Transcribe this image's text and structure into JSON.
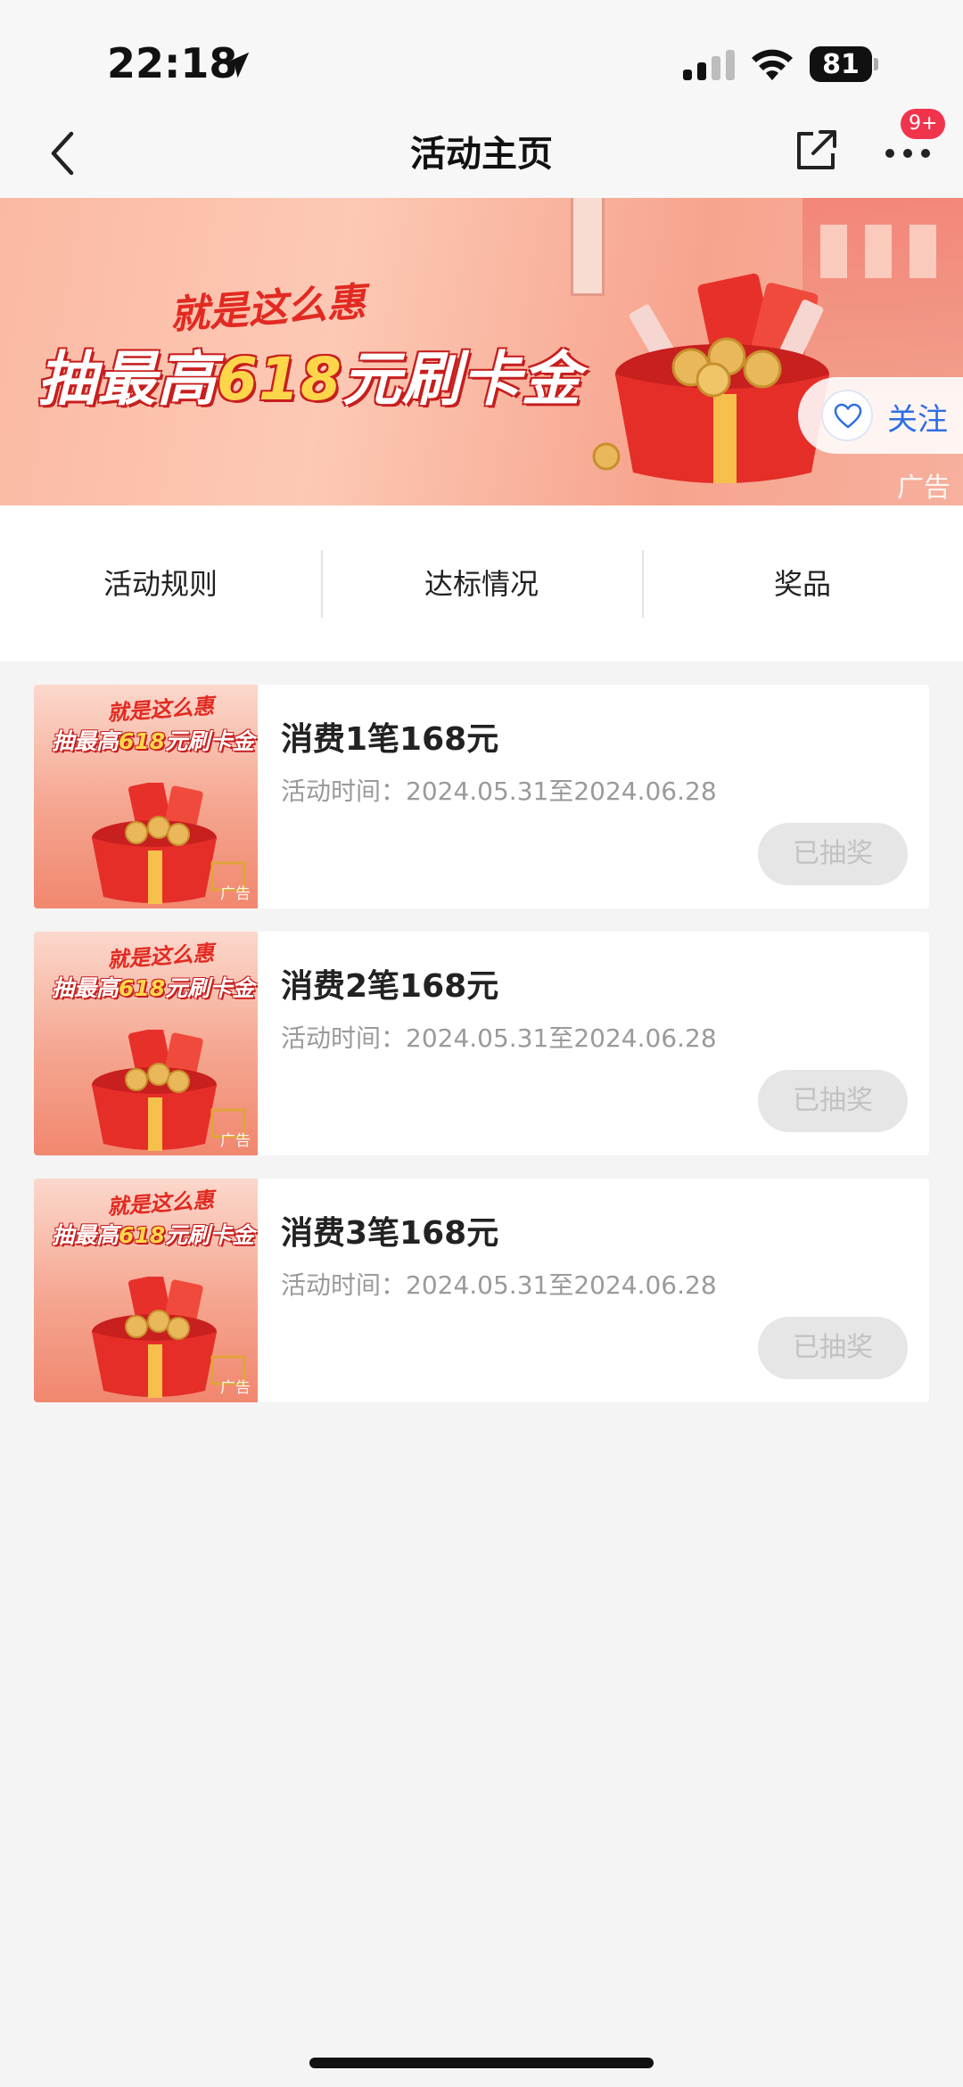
{
  "status_bar": {
    "time": "22:18",
    "battery": "81"
  },
  "nav": {
    "title": "活动主页",
    "badge": "9+"
  },
  "banner": {
    "slogan": "就是这么惠",
    "headline_pre": "抽最高",
    "headline_amount": "618",
    "headline_post": "元刷卡金",
    "ad_label": "广告",
    "follow_label": "关注"
  },
  "tabs": [
    {
      "label": "活动规则"
    },
    {
      "label": "达标情况"
    },
    {
      "label": "奖品"
    }
  ],
  "activities": [
    {
      "title": "消费1笔168元",
      "time": "活动时间：2024.05.31至2024.06.28",
      "button": "已抽奖",
      "thumb_slogan": "就是这么惠",
      "thumb_pre": "抽最高",
      "thumb_amount": "618",
      "thumb_post": "元刷卡金",
      "thumb_ad": "广告"
    },
    {
      "title": "消费2笔168元",
      "time": "活动时间：2024.05.31至2024.06.28",
      "button": "已抽奖",
      "thumb_slogan": "就是这么惠",
      "thumb_pre": "抽最高",
      "thumb_amount": "618",
      "thumb_post": "元刷卡金",
      "thumb_ad": "广告"
    },
    {
      "title": "消费3笔168元",
      "time": "活动时间：2024.05.31至2024.06.28",
      "button": "已抽奖",
      "thumb_slogan": "就是这么惠",
      "thumb_pre": "抽最高",
      "thumb_amount": "618",
      "thumb_post": "元刷卡金",
      "thumb_ad": "广告"
    }
  ],
  "colors": {
    "accent_blue": "#2f6fe4",
    "badge_red": "#f0344c",
    "disabled_bg": "#e6e6e6",
    "disabled_text": "#c2c2c2",
    "page_bg": "#f4f4f5"
  }
}
